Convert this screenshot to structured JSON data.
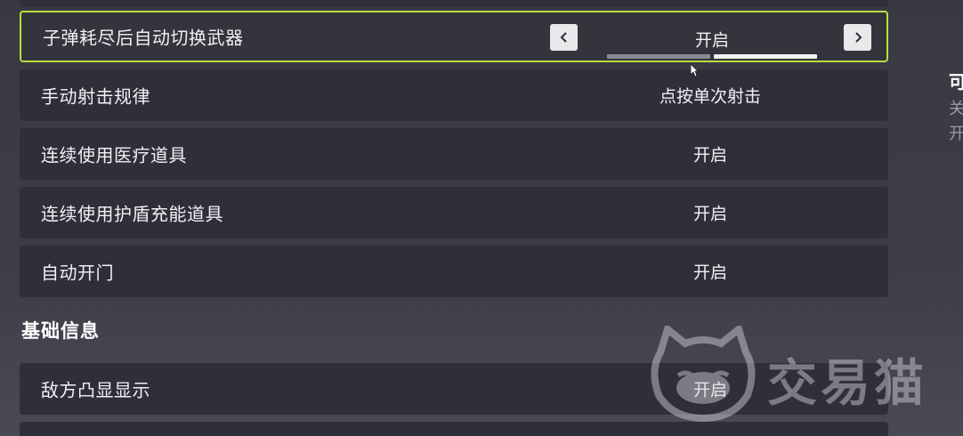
{
  "settings": [
    {
      "label": "子弹耗尽后自动切换武器",
      "value": "开启"
    },
    {
      "label": "手动射击规律",
      "value": "点按单次射击"
    },
    {
      "label": "连续使用医疗道具",
      "value": "开启"
    },
    {
      "label": "连续使用护盾充能道具",
      "value": "开启"
    },
    {
      "label": "自动开门",
      "value": "开启"
    }
  ],
  "section": {
    "title": "基础信息"
  },
  "section_settings": [
    {
      "label": "敌方凸显显示",
      "value": "开启"
    }
  ],
  "selected_option_index": 1,
  "option_count": 2,
  "right_panel": {
    "title": "可",
    "line1": "关",
    "line2": "开"
  },
  "watermark": {
    "text": "交易猫"
  },
  "colors": {
    "accent": "#b7e03e",
    "row_bg": "#2f2f39",
    "page_bg": "#3b3b45"
  },
  "icons": {
    "prev": "chevron-left-icon",
    "next": "chevron-right-icon"
  }
}
